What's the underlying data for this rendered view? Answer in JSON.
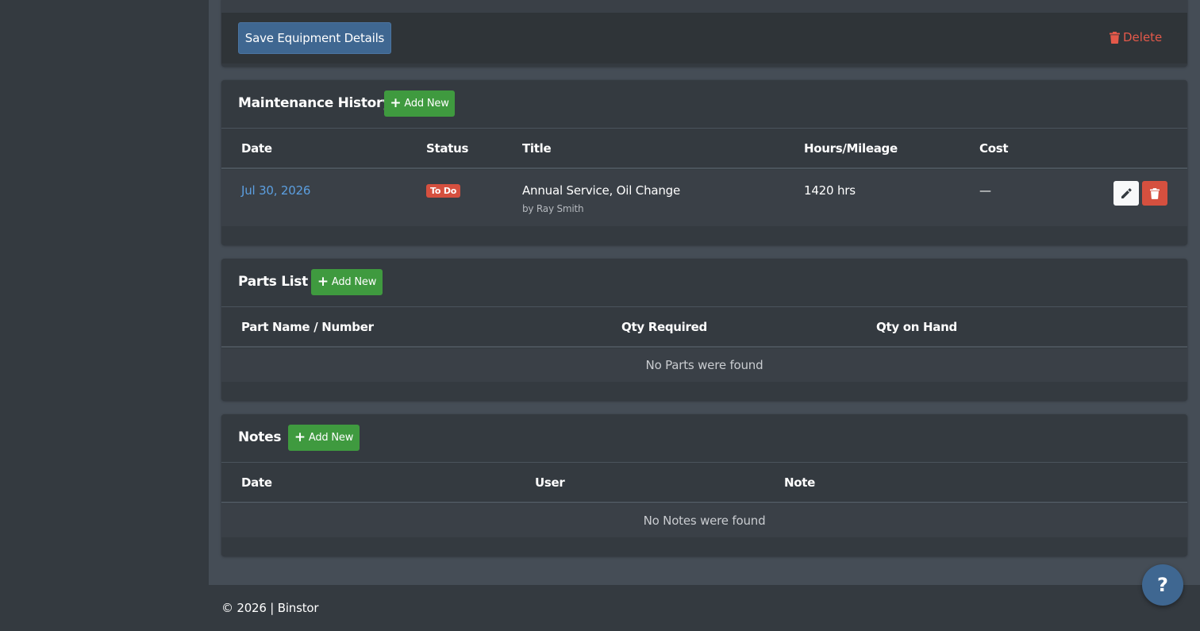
{
  "equipment": {
    "save_label": "Save Equipment Details",
    "delete_label": "Delete"
  },
  "maintenance": {
    "title": "Maintenance History",
    "add_label": "Add New",
    "columns": [
      "Date",
      "Status",
      "Title",
      "Hours/Mileage",
      "Cost"
    ],
    "rows": [
      {
        "date": "Jul 30, 2026",
        "status": "To Do",
        "title": "Annual Service, Oil Change",
        "by": "by Ray Smith",
        "hours": "1420 hrs",
        "cost": "—"
      }
    ]
  },
  "parts": {
    "title": "Parts List",
    "add_label": "Add New",
    "columns": [
      "Part Name / Number",
      "Qty Required",
      "Qty on Hand"
    ],
    "empty": "No Parts were found"
  },
  "notes": {
    "title": "Notes",
    "add_label": "Add New",
    "columns": [
      "Date",
      "User",
      "Note"
    ],
    "empty": "No Notes were found"
  },
  "footer": {
    "text": "© 2026 | Binstor"
  },
  "help": {
    "label": "?"
  },
  "colors": {
    "primary": "#3f6791",
    "success": "#3f9a3f",
    "danger": "#d5503f",
    "link": "#5c9fe0"
  }
}
